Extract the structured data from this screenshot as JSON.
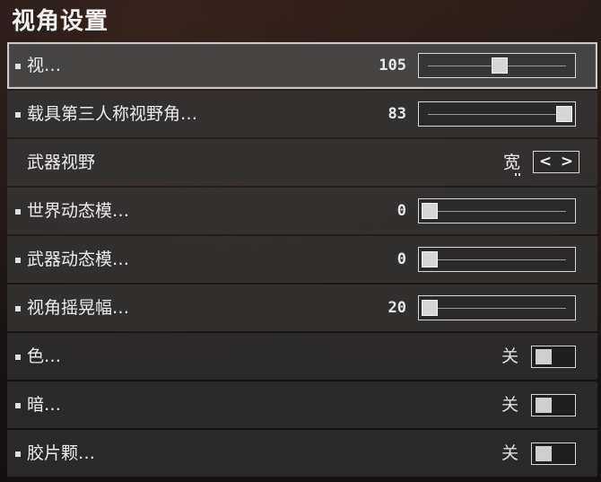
{
  "page": {
    "title": "视角设置"
  },
  "settings": [
    {
      "label": "视…",
      "kind": "slider",
      "value": "105",
      "fill": 0.52,
      "selected": true,
      "bullet": true
    },
    {
      "label": "载具第三人称视野角…",
      "kind": "slider",
      "value": "83",
      "fill": 1.0,
      "selected": false,
      "bullet": true
    },
    {
      "label": "武器视野",
      "kind": "cycler",
      "value": "宽",
      "selected": false,
      "bullet": false,
      "prev_glyph": "<",
      "next_glyph": ">"
    },
    {
      "label": "世界动态模…",
      "kind": "slider",
      "value": "0",
      "fill": 0.0,
      "selected": false,
      "bullet": true
    },
    {
      "label": "武器动态模…",
      "kind": "slider",
      "value": "0",
      "fill": 0.0,
      "selected": false,
      "bullet": true
    },
    {
      "label": "视角摇晃幅…",
      "kind": "slider",
      "value": "20",
      "fill": 0.0,
      "selected": false,
      "bullet": true
    },
    {
      "label": "色…",
      "kind": "toggle",
      "value": "关",
      "on": false,
      "selected": false,
      "bullet": true
    },
    {
      "label": "暗…",
      "kind": "toggle",
      "value": "关",
      "on": false,
      "selected": false,
      "bullet": true
    },
    {
      "label": "胶片颗…",
      "kind": "toggle",
      "value": "关",
      "on": false,
      "selected": false,
      "bullet": true
    }
  ]
}
